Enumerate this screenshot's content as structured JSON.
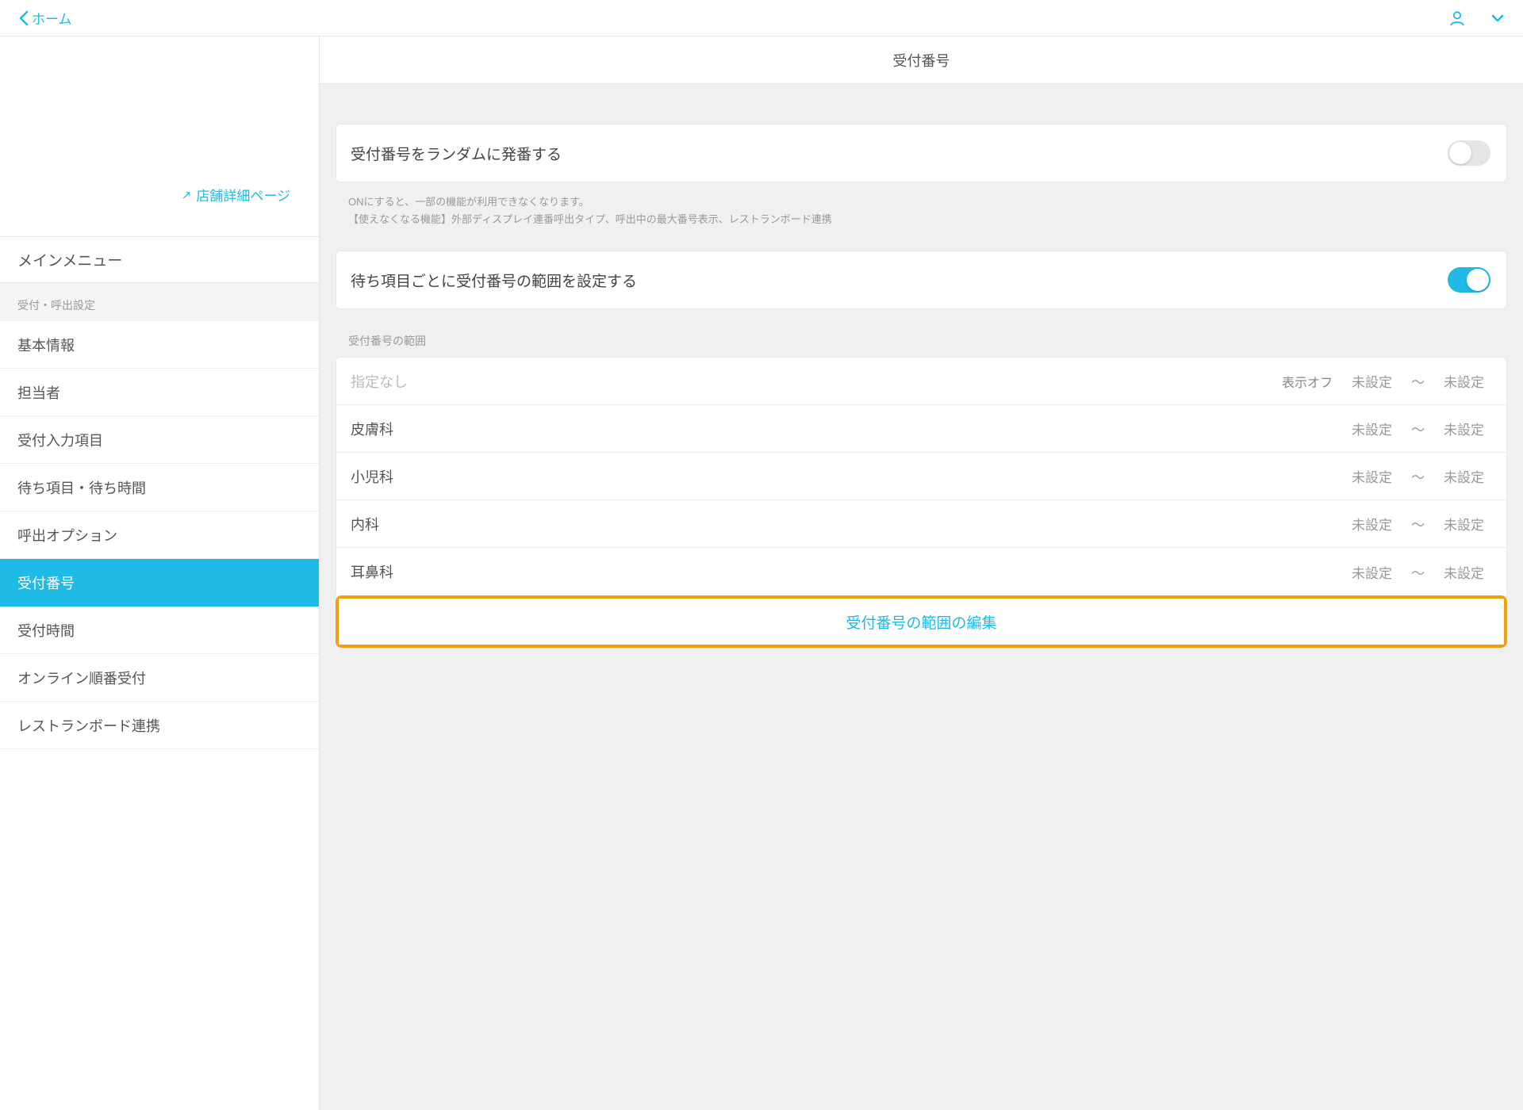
{
  "header": {
    "back_label": "ホーム"
  },
  "sidebar": {
    "store_link": "店舗詳細ページ",
    "main_menu": "メインメニュー",
    "section_title": "受付・呼出設定",
    "items": [
      {
        "label": "基本情報",
        "active": false
      },
      {
        "label": "担当者",
        "active": false
      },
      {
        "label": "受付入力項目",
        "active": false
      },
      {
        "label": "待ち項目・待ち時間",
        "active": false
      },
      {
        "label": "呼出オプション",
        "active": false
      },
      {
        "label": "受付番号",
        "active": true
      },
      {
        "label": "受付時間",
        "active": false
      },
      {
        "label": "オンライン順番受付",
        "active": false
      },
      {
        "label": "レストランボード連携",
        "active": false
      }
    ]
  },
  "content": {
    "title": "受付番号",
    "random_toggle": {
      "label": "受付番号をランダムに発番する",
      "on": false,
      "help_line1": "ONにすると、一部の機能が利用できなくなります。",
      "help_line2": "【使えなくなる機能】外部ディスプレイ連番呼出タイプ、呼出中の最大番号表示、レストランボード連携"
    },
    "range_toggle": {
      "label": "待ち項目ごとに受付番号の範囲を設定する",
      "on": true
    },
    "range_section_title": "受付番号の範囲",
    "range_rows": [
      {
        "name": "指定なし",
        "muted": true,
        "display_off": "表示オフ",
        "from": "未設定",
        "to": "未設定"
      },
      {
        "name": "皮膚科",
        "muted": false,
        "display_off": "",
        "from": "未設定",
        "to": "未設定"
      },
      {
        "name": "小児科",
        "muted": false,
        "display_off": "",
        "from": "未設定",
        "to": "未設定"
      },
      {
        "name": "内科",
        "muted": false,
        "display_off": "",
        "from": "未設定",
        "to": "未設定"
      },
      {
        "name": "耳鼻科",
        "muted": false,
        "display_off": "",
        "from": "未設定",
        "to": "未設定"
      }
    ],
    "range_separator": "～",
    "edit_button": "受付番号の範囲の編集"
  }
}
